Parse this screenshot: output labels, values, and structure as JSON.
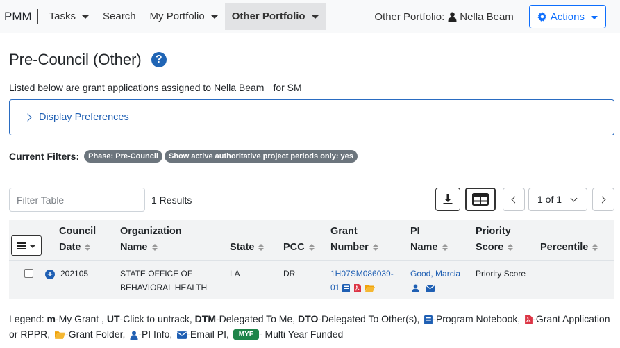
{
  "nav": {
    "brand": "PMM",
    "items": [
      {
        "label": "Tasks",
        "caret": true
      },
      {
        "label": "Search",
        "caret": false
      },
      {
        "label": "My Portfolio",
        "caret": true
      },
      {
        "label": "Other Portfolio",
        "caret": true,
        "active": true
      }
    ],
    "other_portfolio_label": "Other Portfolio:",
    "other_portfolio_user": "Nella Beam",
    "actions_label": "Actions"
  },
  "page": {
    "title": "Pre-Council (Other)",
    "intro_text": "Listed below are grant applications assigned to",
    "intro_name": "Nella Beam",
    "intro_suffix": "for SM",
    "display_preferences": "Display Preferences",
    "filters_label": "Current Filters:",
    "filters": [
      "Phase: Pre-Council",
      "Show active authoritative project periods only: yes"
    ]
  },
  "toolbar": {
    "filter_placeholder": "Filter Table",
    "results": "1 Results",
    "pager": "1 of 1"
  },
  "table": {
    "headers": {
      "council_date": [
        "Council",
        "Date"
      ],
      "organization": [
        "Organization",
        "Name"
      ],
      "state": "State",
      "pcc": "PCC",
      "grant_number": [
        "Grant",
        "Number"
      ],
      "pi_name": [
        "PI",
        "Name"
      ],
      "priority_score": [
        "Priority",
        "Score"
      ],
      "percentile": "Percentile"
    },
    "rows": [
      {
        "council_date": "202105",
        "organization": [
          "STATE OFFICE OF",
          "BEHAVIORAL HEALTH"
        ],
        "state": "LA",
        "pcc": "DR",
        "grant_number": [
          "1H07SM086039-",
          "01"
        ],
        "pi_name": "Good, Marcia",
        "priority_score": "Priority Score",
        "percentile": ""
      }
    ]
  },
  "legend": {
    "prefix": "Legend:",
    "m_key": "m",
    "m_text": "-My Grant ,",
    "ut_key": "UT",
    "ut_text": "-Click to untrack,",
    "dtm_key": "DTM",
    "dtm_text": "-Delegated To Me,",
    "dto_key": "DTO",
    "dto_text": "-Delegated To Other(s),",
    "notebook_text": "-Program Notebook,",
    "pdf_text": "-Grant Application or RPPR,",
    "folder_text": "-Grant Folder,",
    "pi_text": "-PI Info,",
    "email_text": "-Email PI,",
    "myf_badge": "MYF",
    "myf_text": "- Multi Year Funded"
  },
  "colors": {
    "primary": "#1f5fb3",
    "badge_gray": "#6c757d",
    "pdf_red": "#dc3545",
    "folder_orange": "#f0a30a",
    "myf_green": "#1e8449"
  },
  "icons": [
    "user-icon",
    "gear-icon",
    "help-icon",
    "chevron-right-icon",
    "download-icon",
    "columns-icon",
    "chevron-left-icon",
    "chevron-down-icon",
    "menu-icon",
    "plus-circle-icon",
    "notebook-icon",
    "pdf-icon",
    "folder-icon",
    "email-icon"
  ]
}
